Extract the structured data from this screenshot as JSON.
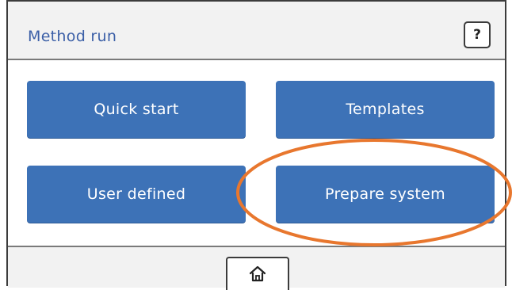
{
  "header": {
    "title": "Method run",
    "help_label": "?"
  },
  "main": {
    "buttons": [
      {
        "label": "Quick start"
      },
      {
        "label": "Templates"
      },
      {
        "label": "User defined"
      },
      {
        "label": "Prepare system"
      }
    ]
  },
  "footer": {
    "home_icon": "home-icon"
  },
  "annotation": {
    "highlight_target": "Prepare system",
    "color": "#e8772e"
  },
  "colors": {
    "button_blue": "#3d72b7",
    "title_blue": "#3b5fa7",
    "panel_gray": "#f2f2f2"
  }
}
